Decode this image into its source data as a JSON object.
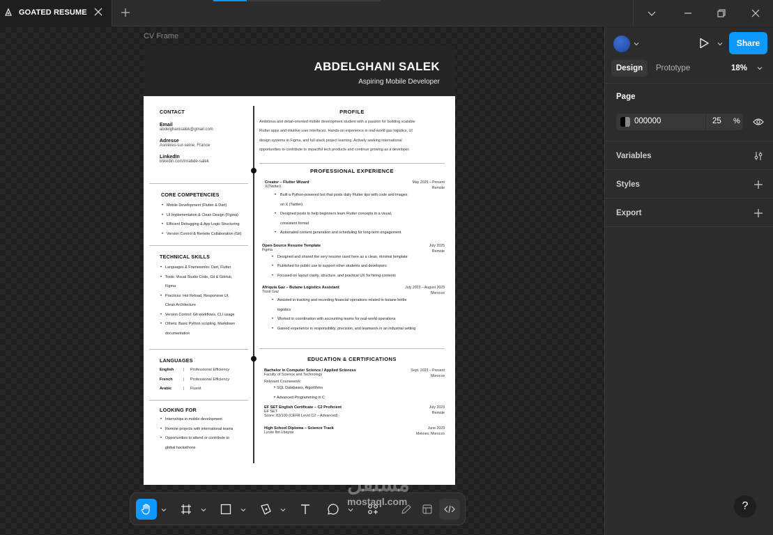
{
  "tab": {
    "title": "GOATED RESUME",
    "file_icon": "figma-file-icon",
    "close_icon": "close-icon",
    "new_tab_icon": "plus-icon"
  },
  "window": {
    "icons": [
      "chevron-down-icon",
      "minimize-icon",
      "restore-icon",
      "close-icon"
    ]
  },
  "canvas": {
    "frame_label": "CV  Frame"
  },
  "cv": {
    "name": "ABDELGHANI SALEK",
    "role": "Aspiring Mobile Developer",
    "contact": {
      "heading": "CONTACT",
      "email_label": "Email",
      "email": "abdelghanisalek@gmail.com",
      "address_label": "Adresse",
      "address": "Asnières-sur-seine, France",
      "linkedin_label": "LinkedIn",
      "linkedin": "linkedin.com/in/abde-salek"
    },
    "competencies": {
      "heading": "CORE COMPETENCIES",
      "items": [
        "Mobile Development (Flutter & Dart)",
        "UI Implementation & Clean Design (Figma)",
        "Efficient Debugging & App Logic Structuring",
        "Version Control & Remote Collaboration (Git)"
      ]
    },
    "skills": {
      "heading": "TECHNICAL SKILLS",
      "items": [
        "Languages & Frameworks: Dart, Flutter",
        "Tools: Visual Studio Code, Git & GitHub,",
        "Figma",
        "Practices: Hot Reload, Responsive UI,",
        "Clean Architecture",
        "Version Control: Git workflows, CLI usage",
        "Others: Basic Python scripting, Markdown",
        "documentation"
      ]
    },
    "languages": {
      "heading": "LANGUAGES",
      "items": [
        {
          "name": "English",
          "sep": "|",
          "level": "Professional Efficiency"
        },
        {
          "name": "French",
          "sep": "|",
          "level": "Professional Efficiency"
        },
        {
          "name": "Arabic",
          "sep": "|",
          "level": "Fluent"
        }
      ]
    },
    "looking": {
      "heading": "LOOKING FOR",
      "items": [
        "Internships in mobile development",
        "Remote projects with international teams",
        "Opportunities to attend or contribute to",
        "global hackathons"
      ]
    },
    "profile": {
      "heading": "PROFILE",
      "lines": [
        "Ambitious and detail-oriented mobile development student with a passion for building scalable",
        "Flutter apps and intuitive user interfaces. Hands-on experience in real-world gas logistics, UI",
        "design systems in Figma, and full-stack project learning. Actively seeking international",
        "opportunities to contribute to impactful tech products and continue growing as a developer."
      ]
    },
    "experience": {
      "heading": "PROFESSIONAL EXPERIENCE",
      "jobs": [
        {
          "title": "Creator – Flutter Wizard",
          "org": "X(Twitter)",
          "date": "May 2025 – Present",
          "loc": "Remote",
          "bullets": [
            "Built a Python-powered bot that posts daily Flutter tips with code and images",
            "on X (Twitter)",
            "Designed posts to help beginners learn Flutter concepts in a visual,",
            "consistent format",
            "Automated content generation and scheduling for long-term engagement"
          ]
        },
        {
          "title": "Open-Source Resume Template",
          "org": "Figma",
          "date": "July 2025",
          "loc": "Remote",
          "bullets": [
            "Designed and shared the very resume used here as a clean, minimal template",
            "Published for public use to support other students and developers",
            "Focused on layout clarity, structure, and practical UX for hiring contexts"
          ]
        },
        {
          "title": "Afriquia Gaz – Butane Logistics Assistant",
          "org": "Tissir Gaz",
          "date": "July 2023 – August 2023",
          "loc": "Morocco",
          "bullets": [
            "Assisted in tracking and recording financial operations related to butane bottle",
            "logistics",
            "Worked in coordination with accounting teams for real-world operations",
            "Gained experience in responsibility, precision, and teamwork in an industrial setting"
          ]
        }
      ]
    },
    "education": {
      "heading": "EDUCATION & CERTIFICATIONS",
      "items": [
        {
          "title": "Bachelor in Computer Science / Applied Sciences",
          "org": "Faculty of Science and Technology",
          "date": "Sept. 2023 – Present",
          "loc": "Morocco"
        },
        {
          "title": "EF SET English Certificate – C2 Proficient",
          "org": "EF SET",
          "date": "July 2023",
          "loc": "Remote"
        },
        {
          "title": "High School Diploma – Science Track",
          "org": "Lycée Ibn Lbaytar",
          "date": "June 2023",
          "loc": "Meknes, Morocco"
        }
      ],
      "coursework_label": "Relevant Coursework:",
      "coursework": [
        "SQL Databases, Algorithms",
        "Advanced Programming in C"
      ],
      "score": "Score: 83/100 (CEFR Level C2 – Advanced)"
    }
  },
  "toolbar": {
    "tools": [
      "hand-icon",
      "frame-icon",
      "rectangle-icon",
      "pen-icon",
      "text-icon",
      "comment-icon",
      "actions-icon",
      "pencil-draw-icon",
      "component-icon",
      "dev-mode-icon"
    ],
    "active": "hand-icon"
  },
  "watermark": {
    "arabic": "مستقل",
    "latin": "mostaql.com"
  },
  "panel": {
    "share": "Share",
    "tabs": {
      "design": "Design",
      "prototype": "Prototype"
    },
    "zoom": "18%",
    "page_title": "Page",
    "page_color": "000000",
    "page_opacity": "25",
    "opacity_unit": "%",
    "sections": [
      "Variables",
      "Styles",
      "Export"
    ],
    "help": "?",
    "accent": "#0d99ff"
  }
}
